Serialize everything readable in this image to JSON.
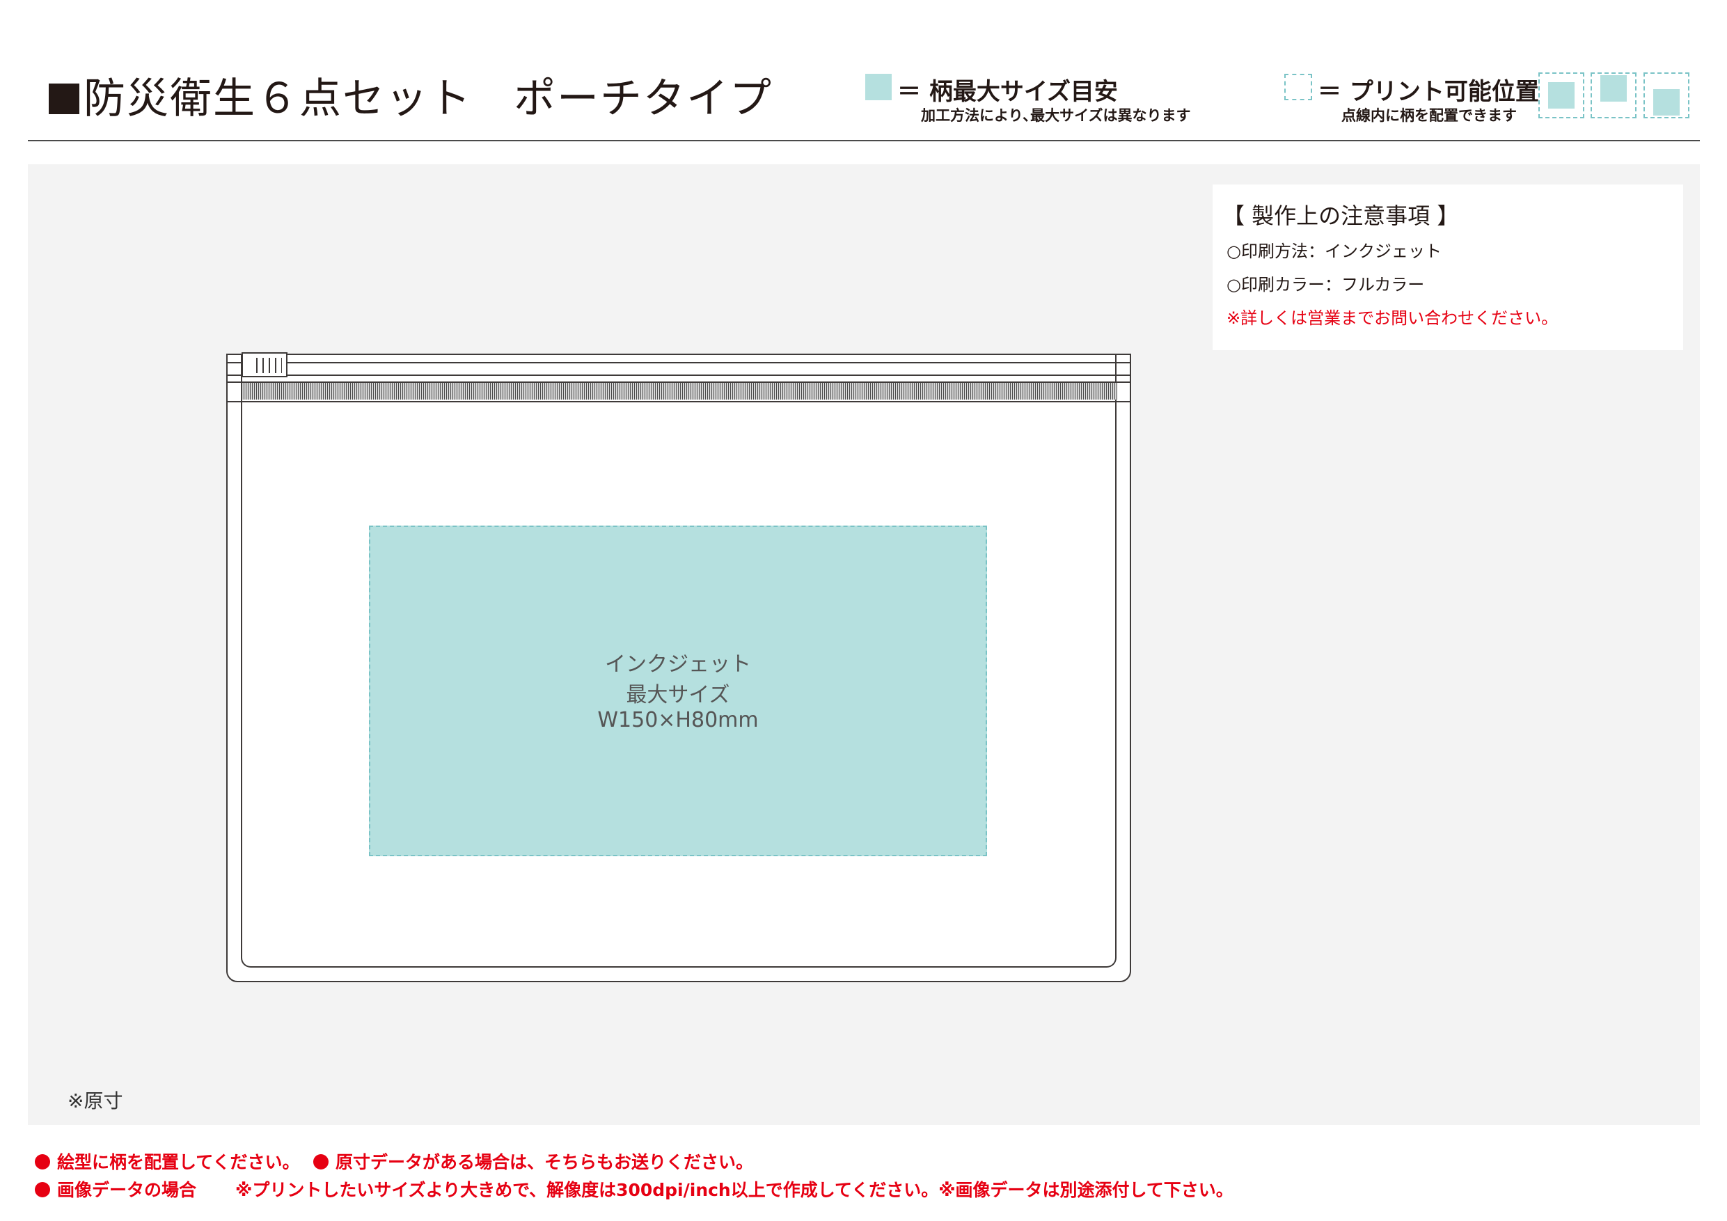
{
  "header": {
    "title_main": "防災衛生６点セット",
    "title_sub": "ポーチタイプ",
    "legend_fill_label": "＝ 柄最大サイズ目安",
    "legend_fill_note": "加工方法により､最大サイズは異なります",
    "legend_dash_label": "＝ プリント可能位置",
    "legend_dash_note": "点線内に柄を配置できます"
  },
  "notes": {
    "heading": "【 製作上の注意事項 】",
    "method": "○印刷方法：インクジェット",
    "color": "○印刷カラー：フルカラー",
    "contact": "※詳しくは営業までお問い合わせください。"
  },
  "print_area": {
    "line1": "インクジェット",
    "line2": "最大サイズ",
    "line3": "W150×H80mm"
  },
  "scale_note": "※原寸",
  "footer": {
    "note1": "絵型に柄を配置してください。",
    "note2": "原寸データがある場合は、そちらもお送りください。",
    "note3_label": "画像データの場合",
    "note3_text": "※プリントしたいサイズより大きめで、解像度は300dpi/inch以上で作成してください。※画像データは別途添付して下さい。"
  },
  "colors": {
    "print_fill": "#b5e0df",
    "print_dash": "#7ac3c6",
    "alert_red": "#e60012",
    "ink": "#231815",
    "canvas_bg": "#f3f3f3"
  }
}
